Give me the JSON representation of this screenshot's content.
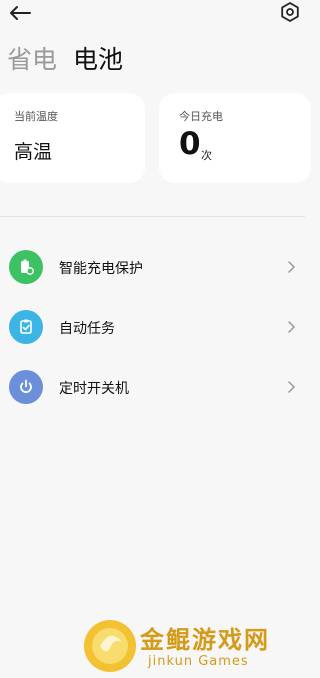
{
  "tabs": [
    {
      "label": "省电",
      "active": false
    },
    {
      "label": "电池",
      "active": true
    }
  ],
  "cards": {
    "temperature": {
      "label": "当前温度",
      "value": "高温"
    },
    "charge_count": {
      "label": "今日充电",
      "value": "0",
      "unit": "次"
    }
  },
  "list": [
    {
      "label": "智能充电保护",
      "icon": "battery-shield-icon",
      "color": "#3cc262"
    },
    {
      "label": "自动任务",
      "icon": "clipboard-icon",
      "color": "#3cb4e6"
    },
    {
      "label": "定时开关机",
      "icon": "power-icon",
      "color": "#6b8fd8"
    }
  ],
  "watermark": {
    "title": "金鲲游戏网",
    "subtitle": "jinkun Games"
  },
  "colors": {
    "background": "#f7f7f7",
    "card": "#ffffff",
    "watermark": "#d59a17"
  }
}
